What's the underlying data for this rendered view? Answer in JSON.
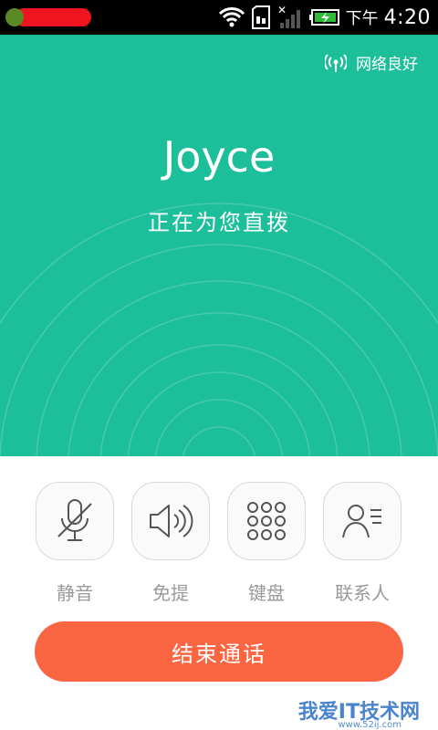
{
  "status_bar": {
    "ampm": "下午",
    "time": "4:20"
  },
  "call": {
    "network_status": "网络良好",
    "contact_name": "Joyce",
    "call_state": "正在为您直拨"
  },
  "controls": [
    {
      "label": "静音",
      "icon": "mic-off-icon"
    },
    {
      "label": "免提",
      "icon": "speaker-icon"
    },
    {
      "label": "键盘",
      "icon": "keypad-icon"
    },
    {
      "label": "联系人",
      "icon": "contacts-icon"
    }
  ],
  "end_call_label": "结束通话",
  "watermark": {
    "text": "我爱IT技术网",
    "sub": "www.52ij.com"
  },
  "colors": {
    "header_bg": "#1dbf9b",
    "end_call_bg": "#fa6641",
    "label_gray": "#9a9a9a"
  }
}
